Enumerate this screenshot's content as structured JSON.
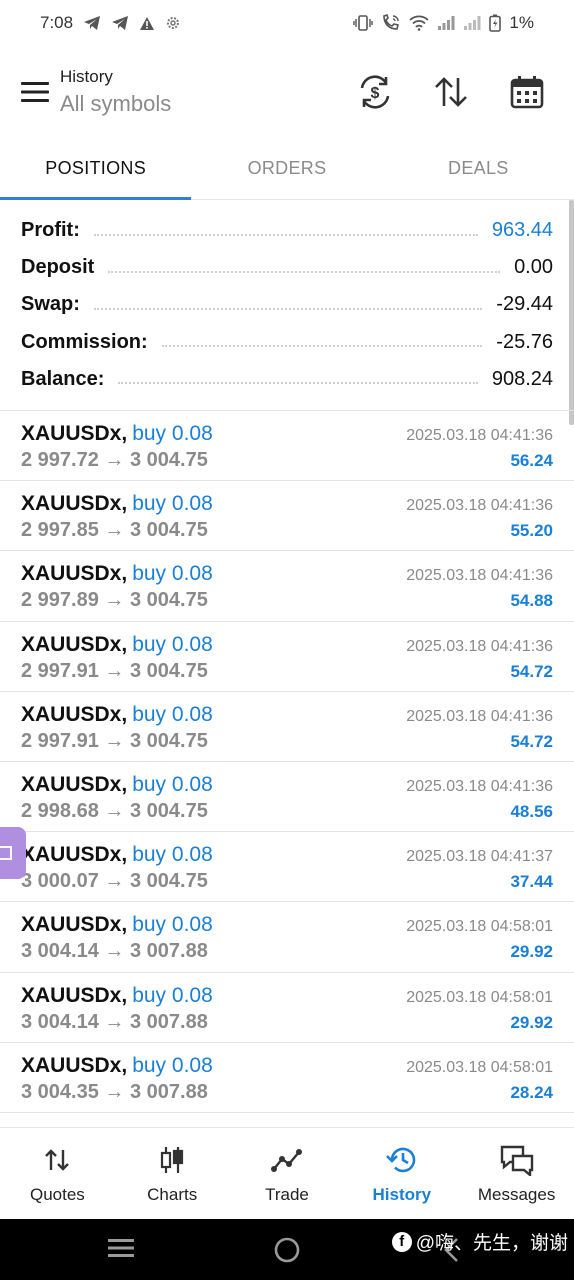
{
  "status_bar": {
    "time": "7:08",
    "battery": "1%"
  },
  "toolbar": {
    "title": "History",
    "subtitle": "All symbols"
  },
  "tabs": [
    {
      "label": "POSITIONS",
      "active": true
    },
    {
      "label": "ORDERS",
      "active": false
    },
    {
      "label": "DEALS",
      "active": false
    }
  ],
  "summary": {
    "profit": {
      "label": "Profit:",
      "value": "963.44"
    },
    "deposit": {
      "label": "Deposit",
      "value": "0.00"
    },
    "swap": {
      "label": "Swap:",
      "value": "-29.44"
    },
    "commission": {
      "label": "Commission:",
      "value": "-25.76"
    },
    "balance": {
      "label": "Balance:",
      "value": "908.24"
    }
  },
  "positions": [
    {
      "symbol": "XAUUSDx,",
      "side": "buy 0.08",
      "time": "2025.03.18 04:41:36",
      "prices": "2 997.72 → 3 004.75",
      "profit": "56.24"
    },
    {
      "symbol": "XAUUSDx,",
      "side": "buy 0.08",
      "time": "2025.03.18 04:41:36",
      "prices": "2 997.85 → 3 004.75",
      "profit": "55.20"
    },
    {
      "symbol": "XAUUSDx,",
      "side": "buy 0.08",
      "time": "2025.03.18 04:41:36",
      "prices": "2 997.89 → 3 004.75",
      "profit": "54.88"
    },
    {
      "symbol": "XAUUSDx,",
      "side": "buy 0.08",
      "time": "2025.03.18 04:41:36",
      "prices": "2 997.91 → 3 004.75",
      "profit": "54.72"
    },
    {
      "symbol": "XAUUSDx,",
      "side": "buy 0.08",
      "time": "2025.03.18 04:41:36",
      "prices": "2 997.91 → 3 004.75",
      "profit": "54.72"
    },
    {
      "symbol": "XAUUSDx,",
      "side": "buy 0.08",
      "time": "2025.03.18 04:41:36",
      "prices": "2 998.68 → 3 004.75",
      "profit": "48.56"
    },
    {
      "symbol": "XAUUSDx,",
      "side": "buy 0.08",
      "time": "2025.03.18 04:41:37",
      "prices": "3 000.07 → 3 004.75",
      "profit": "37.44"
    },
    {
      "symbol": "XAUUSDx,",
      "side": "buy 0.08",
      "time": "2025.03.18 04:58:01",
      "prices": "3 004.14 → 3 007.88",
      "profit": "29.92"
    },
    {
      "symbol": "XAUUSDx,",
      "side": "buy 0.08",
      "time": "2025.03.18 04:58:01",
      "prices": "3 004.14 → 3 007.88",
      "profit": "29.92"
    },
    {
      "symbol": "XAUUSDx,",
      "side": "buy 0.08",
      "time": "2025.03.18 04:58:01",
      "prices": "3 004.35 → 3 007.88",
      "profit": "28.24"
    }
  ],
  "bottom_nav": [
    {
      "label": "Quotes",
      "icon": "quotes-icon",
      "active": false
    },
    {
      "label": "Charts",
      "icon": "charts-icon",
      "active": false
    },
    {
      "label": "Trade",
      "icon": "trade-icon",
      "active": false
    },
    {
      "label": "History",
      "icon": "history-icon",
      "active": true
    },
    {
      "label": "Messages",
      "icon": "messages-icon",
      "active": false
    }
  ],
  "watermark": "@嗨、先生，谢谢",
  "colors": {
    "accent": "#1a7fd6",
    "tab_underline": "#2f80d7",
    "muted": "#8a8a8a",
    "side_tab": "#b08fe0"
  }
}
